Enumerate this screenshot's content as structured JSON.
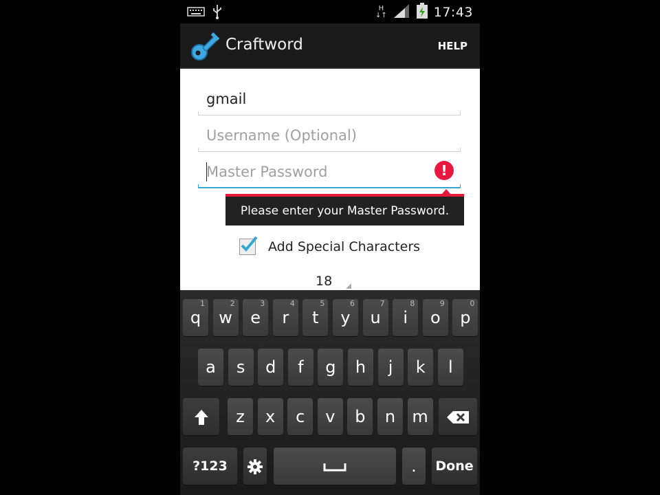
{
  "statusbar": {
    "time": "17:43",
    "network_label": "H",
    "icons": [
      "keyboard-icon",
      "usb-icon",
      "signal-icon",
      "battery-icon"
    ]
  },
  "app": {
    "title": "Craftword",
    "help_label": "HELP",
    "icon": "key-icon"
  },
  "form": {
    "site": {
      "value": "gmail"
    },
    "username": {
      "placeholder": "Username (Optional)",
      "value": ""
    },
    "master_password": {
      "placeholder": "Master Password",
      "value": ""
    }
  },
  "error": {
    "message": "Please enter your Master Password."
  },
  "options": {
    "special_chars_label": "Add Special Characters",
    "special_chars_checked": true
  },
  "length": {
    "value": "18"
  },
  "keyboard": {
    "row1": [
      {
        "k": "q",
        "n": "1"
      },
      {
        "k": "w",
        "n": "2"
      },
      {
        "k": "e",
        "n": "3"
      },
      {
        "k": "r",
        "n": "4"
      },
      {
        "k": "t",
        "n": "5"
      },
      {
        "k": "y",
        "n": "6"
      },
      {
        "k": "u",
        "n": "7"
      },
      {
        "k": "i",
        "n": "8"
      },
      {
        "k": "o",
        "n": "9"
      },
      {
        "k": "p",
        "n": "0"
      }
    ],
    "row2": [
      "a",
      "s",
      "d",
      "f",
      "g",
      "h",
      "j",
      "k",
      "l"
    ],
    "row3": [
      "z",
      "x",
      "c",
      "v",
      "b",
      "n",
      "m"
    ],
    "symbols_label": "?123",
    "period_label": ".",
    "done_label": "Done"
  },
  "colors": {
    "accent": "#33a8d4",
    "error": "#e8173d"
  }
}
